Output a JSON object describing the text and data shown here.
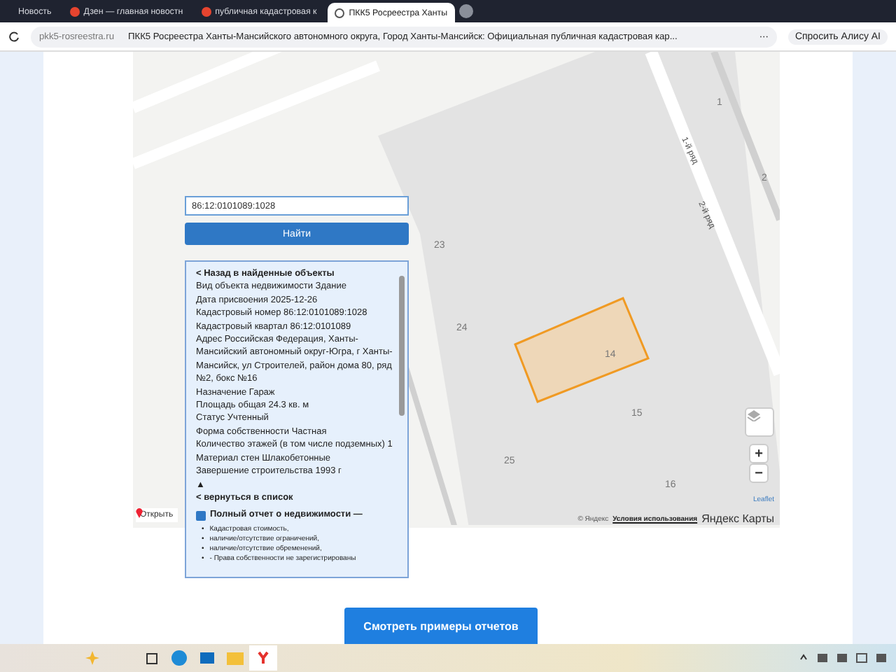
{
  "browser": {
    "tabs": [
      {
        "title": "Новость",
        "selected": false
      },
      {
        "title": "Дзен — главная новостн",
        "selected": false
      },
      {
        "title": "публичная кадастровая к",
        "selected": false
      },
      {
        "title": "ПКК5 Росреестра Ханты",
        "selected": true
      }
    ],
    "address": {
      "domain": "pkk5-rosreestra.ru",
      "title": "ПКК5 Росреестра Ханты-Мансийского автономного округа, Город Ханты-Мансийск: Официальная публичная кадастровая кар...",
      "more": "···",
      "assistant": "Спросить Алису AI"
    }
  },
  "map": {
    "labels": [
      {
        "text": "1",
        "kind": "number"
      },
      {
        "text": "2",
        "kind": "number"
      },
      {
        "text": "23",
        "kind": "number"
      },
      {
        "text": "24",
        "kind": "number"
      },
      {
        "text": "14",
        "kind": "number"
      },
      {
        "text": "15",
        "kind": "number"
      },
      {
        "text": "25",
        "kind": "number"
      },
      {
        "text": "16",
        "kind": "number"
      },
      {
        "text": "1-й ряд",
        "kind": "road"
      },
      {
        "text": "2-й ряд",
        "kind": "road"
      }
    ],
    "zoom_in": "+",
    "zoom_out": "−",
    "leaflet": "Leaflet",
    "copyright": "© Яндекс",
    "terms": "Условия использования",
    "brand": "Яндекс Карты",
    "open_link": "Открыть"
  },
  "search": {
    "value": "86:12:0101089:1028",
    "button": "Найти"
  },
  "info": {
    "back_link": "< Назад в найденные объекты",
    "fields": [
      "Вид объекта недвижимости Здание",
      "Дата присвоения 2025-12-26",
      "Кадастровый номер 86:12:0101089:1028",
      "Кадастровый квартал 86:12:0101089",
      "Адрес Российская Федерация, Ханты-Мансийский автономный округ-Югра, г Ханты-Мансийск, ул Строителей, район дома 80, ряд №2, бокс №16",
      "Назначение Гараж",
      "Площадь общая 24.3 кв. м",
      "Статус Учтенный",
      "Форма собственности Частная",
      "Количество этажей (в том числе подземных) 1",
      "Материал стен Шлакобетонные",
      "Завершение строительства 1993 г"
    ],
    "collapse": "▲",
    "return_link": "< вернуться в список",
    "report": {
      "marker": "•",
      "label": "Полный отчет о недвижимости —",
      "checked": true,
      "items": [
        "Кадастровая стоимость,",
        "наличие/отсутствие ограничений,",
        "наличие/отсутствие обременений,",
        "- Права собственности не зарегистрированы"
      ]
    }
  },
  "examples_button": "Смотреть примеры отчетов"
}
